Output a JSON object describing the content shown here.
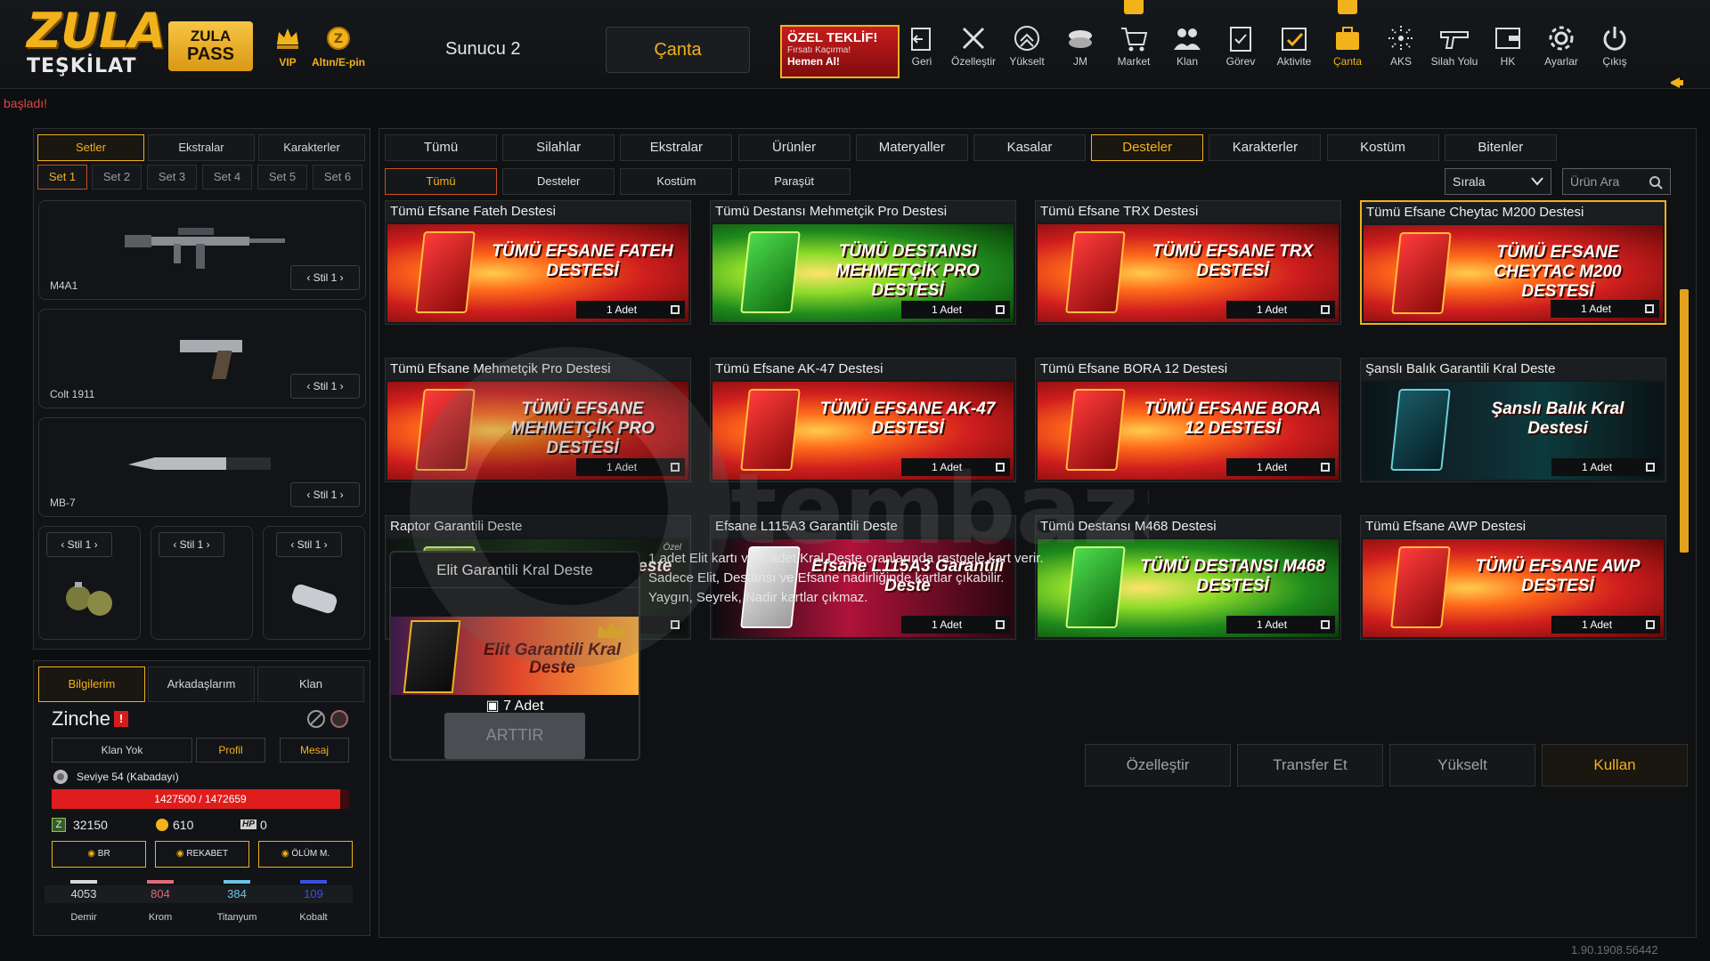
{
  "brand": {
    "logo_top": "ZULA",
    "logo_bottom": "TEŞKİLAT",
    "pass_line1": "ZULA",
    "pass_line2": "PASS",
    "vip": "VIP",
    "altin": "Altın/E-pin"
  },
  "header": {
    "server": "Sunucu 2",
    "bag_button": "Çanta",
    "offer_title": "ÖZEL TEKLİF!",
    "offer_sub": "Fırsatı Kaçırma!",
    "offer_cta": "Hemen Al!"
  },
  "nav": [
    {
      "label": "Geri",
      "icon": "back-icon"
    },
    {
      "label": "Özelleştir",
      "icon": "tools-icon"
    },
    {
      "label": "Yükselt",
      "icon": "upgrade-icon"
    },
    {
      "label": "JM",
      "icon": "jm-icon"
    },
    {
      "label": "Market",
      "icon": "cart-icon"
    },
    {
      "label": "Klan",
      "icon": "clan-icon"
    },
    {
      "label": "Görev",
      "icon": "task-icon"
    },
    {
      "label": "Aktivite",
      "icon": "activity-icon"
    },
    {
      "label": "Çanta",
      "icon": "bag-icon"
    },
    {
      "label": "AKS",
      "icon": "aks-icon"
    },
    {
      "label": "Silah Yolu",
      "icon": "gun-icon"
    },
    {
      "label": "HK",
      "icon": "hk-icon"
    },
    {
      "label": "Ayarlar",
      "icon": "gear-icon"
    },
    {
      "label": "Çıkış",
      "icon": "power-icon"
    }
  ],
  "notice": "başladı!",
  "left": {
    "tabs": [
      "Setler",
      "Ekstralar",
      "Karakterler"
    ],
    "sets": [
      "Set 1",
      "Set 2",
      "Set 3",
      "Set 4",
      "Set 5",
      "Set 6"
    ],
    "weapons": [
      {
        "name": "M4A1",
        "style": "Stil 1"
      },
      {
        "name": "Colt 1911",
        "style": "Stil 1"
      },
      {
        "name": "MB-7",
        "style": "Stil 1"
      }
    ],
    "grenade_styles": [
      "Stil 1",
      "Stil 1",
      "Stil 1"
    ]
  },
  "profile": {
    "tabs": [
      "Bilgilerim",
      "Arkadaşlarım",
      "Klan"
    ],
    "name": "Zinche",
    "buttons": [
      "Klan Yok",
      "Profil",
      "Mesaj"
    ],
    "level": "Seviye 54 (Kabadayı)",
    "xp": "1427500 / 1472659",
    "xp_fraction": 0.969,
    "zula_points": "32150",
    "gold": "610",
    "hp": "0",
    "modes": [
      "BR",
      "REKABET",
      "ÖLÜM M."
    ],
    "materials": [
      {
        "name": "Demir",
        "value": "4053",
        "color": "#d9d9d9"
      },
      {
        "name": "Krom",
        "value": "804",
        "color": "#e06a78"
      },
      {
        "name": "Titanyum",
        "value": "384",
        "color": "#6ac3e6"
      },
      {
        "name": "Kobalt",
        "value": "109",
        "color": "#3a4fe0"
      }
    ]
  },
  "main": {
    "categories": [
      "Tümü",
      "Silahlar",
      "Ekstralar",
      "Ürünler",
      "Materyaller",
      "Kasalar",
      "Desteler",
      "Karakterler",
      "Kostüm",
      "Bitenler"
    ],
    "subcategories": [
      "Tümü",
      "Desteler",
      "Kostüm",
      "Paraşüt"
    ],
    "sort": "Sırala",
    "search_placeholder": "Ürün Ara",
    "cards": [
      {
        "title": "Tümü Efsane Fateh Destesi",
        "art": "TÜMÜ EFSANE FATEH DESTESİ",
        "qty": "1 Adet",
        "theme": "red"
      },
      {
        "title": "Tümü Destansı Mehmetçik Pro Destesi",
        "art": "TÜMÜ DESTANSI MEHMETÇİK PRO DESTESİ",
        "qty": "1 Adet",
        "theme": "green"
      },
      {
        "title": "Tümü Efsane TRX Destesi",
        "art": "TÜMÜ EFSANE TRX DESTESİ",
        "qty": "1 Adet",
        "theme": "red"
      },
      {
        "title": "Tümü Efsane Cheytac M200 Destesi",
        "art": "TÜMÜ EFSANE CHEYTAC M200 DESTESİ",
        "qty": "1 Adet",
        "theme": "red"
      },
      {
        "title": "Tümü Efsane Mehmetçik Pro Destesi",
        "art": "TÜMÜ EFSANE MEHMETÇİK PRO DESTESİ",
        "qty": "1 Adet",
        "theme": "red"
      },
      {
        "title": "Tümü Efsane AK-47 Destesi",
        "art": "TÜMÜ EFSANE AK-47 DESTESİ",
        "qty": "1 Adet",
        "theme": "red"
      },
      {
        "title": "Tümü Efsane BORA 12 Destesi",
        "art": "TÜMÜ EFSANE BORA 12 DESTESİ",
        "qty": "1 Adet",
        "theme": "red"
      },
      {
        "title": "Şanslı Balık Garantili Kral Deste",
        "art": "Şanslı Balık Kral Destesi",
        "qty": "1 Adet",
        "theme": "teal"
      },
      {
        "title": "Raptor Garantili Deste",
        "art": "Raptor Garantili Deste",
        "qty": "1 Adet",
        "theme": "olive"
      },
      {
        "title": "Efsane L115A3 Garantili Deste",
        "art": "Efsane L115A3 Garantili Deste",
        "qty": "1 Adet",
        "theme": "pink"
      },
      {
        "title": "Tümü Destansı M468 Destesi",
        "art": "TÜMÜ DESTANSI M468 DESTESİ",
        "qty": "1 Adet",
        "theme": "green"
      },
      {
        "title": "Tümü Efsane AWP Destesi",
        "art": "TÜMÜ EFSANE AWP DESTESİ",
        "qty": "1 Adet",
        "theme": "red"
      }
    ],
    "card_tag_ozel": "Özel",
    "detail": {
      "title": "Elit Garantili Kral Deste",
      "art": "Elit Garantili Kral Deste",
      "qty": "7 Adet",
      "increase": "ARTTIR"
    },
    "description": [
      "1 adet Elit kartı ve 4 adet Kral Deste oranlarında rastgele kart verir.",
      "Sadece Elit, Destansı ve Efsane nadirliğinde kartlar çıkabilir.",
      "Yaygın, Seyrek, Nadir kartlar çıkmaz."
    ],
    "actions": [
      "Özelleştir",
      "Transfer Et",
      "Yükselt",
      "Kullan"
    ]
  },
  "version": "1.90.1908.56442",
  "watermark": "tembazar.com",
  "colors": {
    "accent": "#f1b21b",
    "danger": "#e01d1d"
  }
}
